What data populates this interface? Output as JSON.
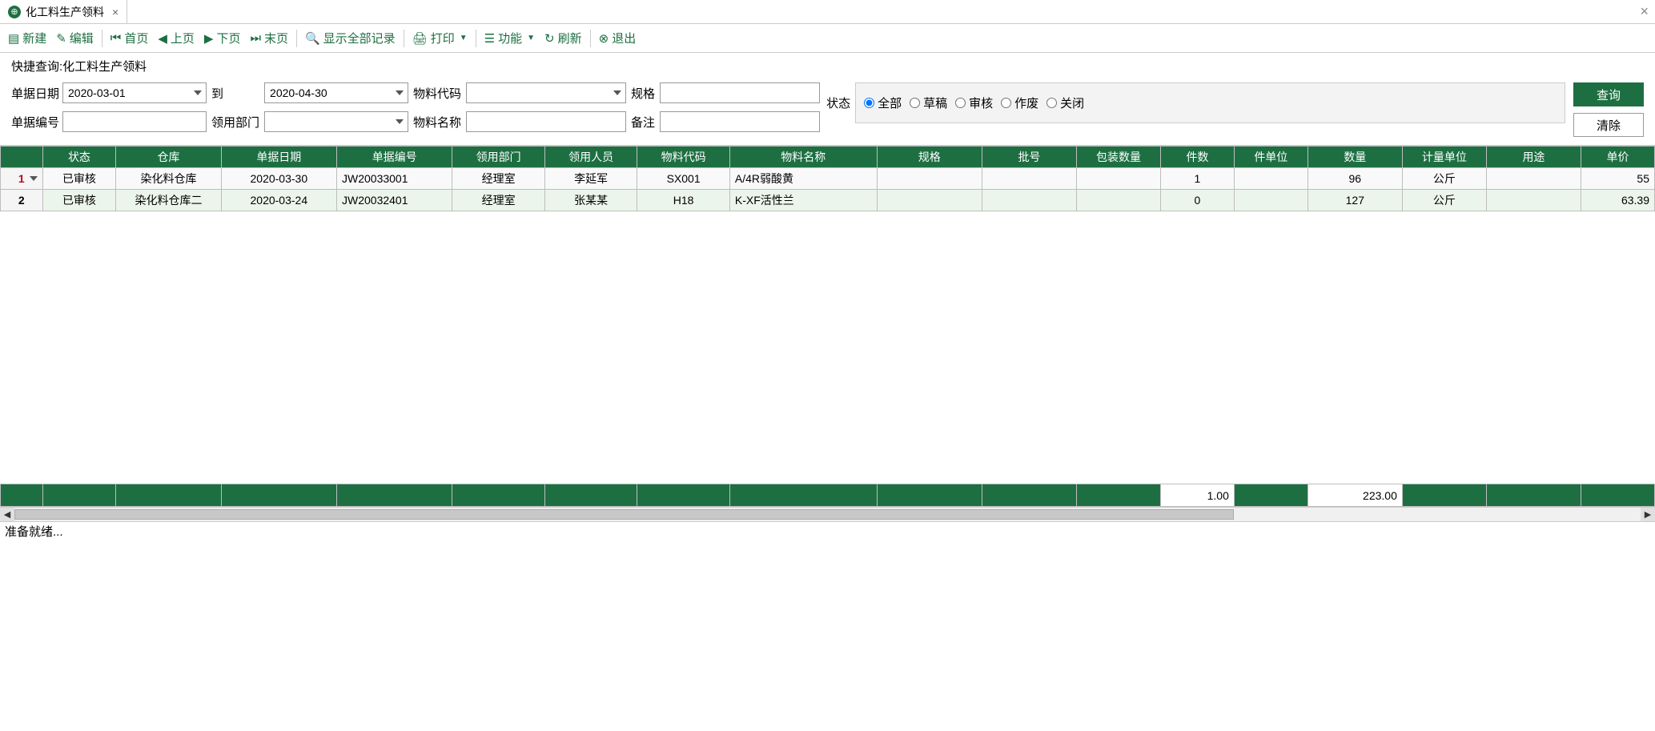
{
  "tab": {
    "title": "化工料生产领料",
    "icon_char": "⊕"
  },
  "toolbar": {
    "new": "新建",
    "edit": "编辑",
    "first": "首页",
    "prev": "上页",
    "next": "下页",
    "last": "末页",
    "show_all": "显示全部记录",
    "print": "打印",
    "functions": "功能",
    "refresh": "刷新",
    "exit": "退出"
  },
  "search_title": "快捷查询:化工料生产领料",
  "filters": {
    "date_label": "单据日期",
    "date_from": "2020-03-01",
    "to": "到",
    "date_to": "2020-04-30",
    "matcode_label": "物料代码",
    "matcode": "",
    "spec_label": "规格",
    "spec": "",
    "docno_label": "单据编号",
    "docno": "",
    "dept_label": "领用部门",
    "dept": "",
    "matname_label": "物料名称",
    "matname": "",
    "remark_label": "备注",
    "remark": "",
    "status_label": "状态",
    "status_options": {
      "all": "全部",
      "draft": "草稿",
      "audited": "审核",
      "void": "作废",
      "closed": "关闭"
    },
    "status_selected": "all",
    "query_btn": "查询",
    "clear_btn": "清除"
  },
  "table": {
    "headers": [
      "状态",
      "仓库",
      "单据日期",
      "单据编号",
      "领用部门",
      "领用人员",
      "物料代码",
      "物料名称",
      "规格",
      "批号",
      "包装数量",
      "件数",
      "件单位",
      "数量",
      "计量单位",
      "用途",
      "单价"
    ],
    "rows": [
      {
        "status": "已审核",
        "warehouse": "染化料仓库",
        "date": "2020-03-30",
        "docno": "JW20033001",
        "dept": "经理室",
        "person": "李延军",
        "matcode": "SX001",
        "matname": "A/4R弱酸黄",
        "spec": "",
        "batch": "",
        "packqty": "",
        "pieces": "1",
        "pieceunit": "",
        "qty": "96",
        "unit": "公斤",
        "use": "",
        "price": "55"
      },
      {
        "status": "已审核",
        "warehouse": "染化料仓库二",
        "date": "2020-03-24",
        "docno": "JW20032401",
        "dept": "经理室",
        "person": "张某某",
        "matcode": "H18",
        "matname": "K-XF活性兰",
        "spec": "",
        "batch": "",
        "packqty": "",
        "pieces": "0",
        "pieceunit": "",
        "qty": "127",
        "unit": "公斤",
        "use": "",
        "price": "63.39"
      }
    ],
    "footer": {
      "pieces_total": "1.00",
      "qty_total": "223.00"
    }
  },
  "statusbar": "准备就绪..."
}
